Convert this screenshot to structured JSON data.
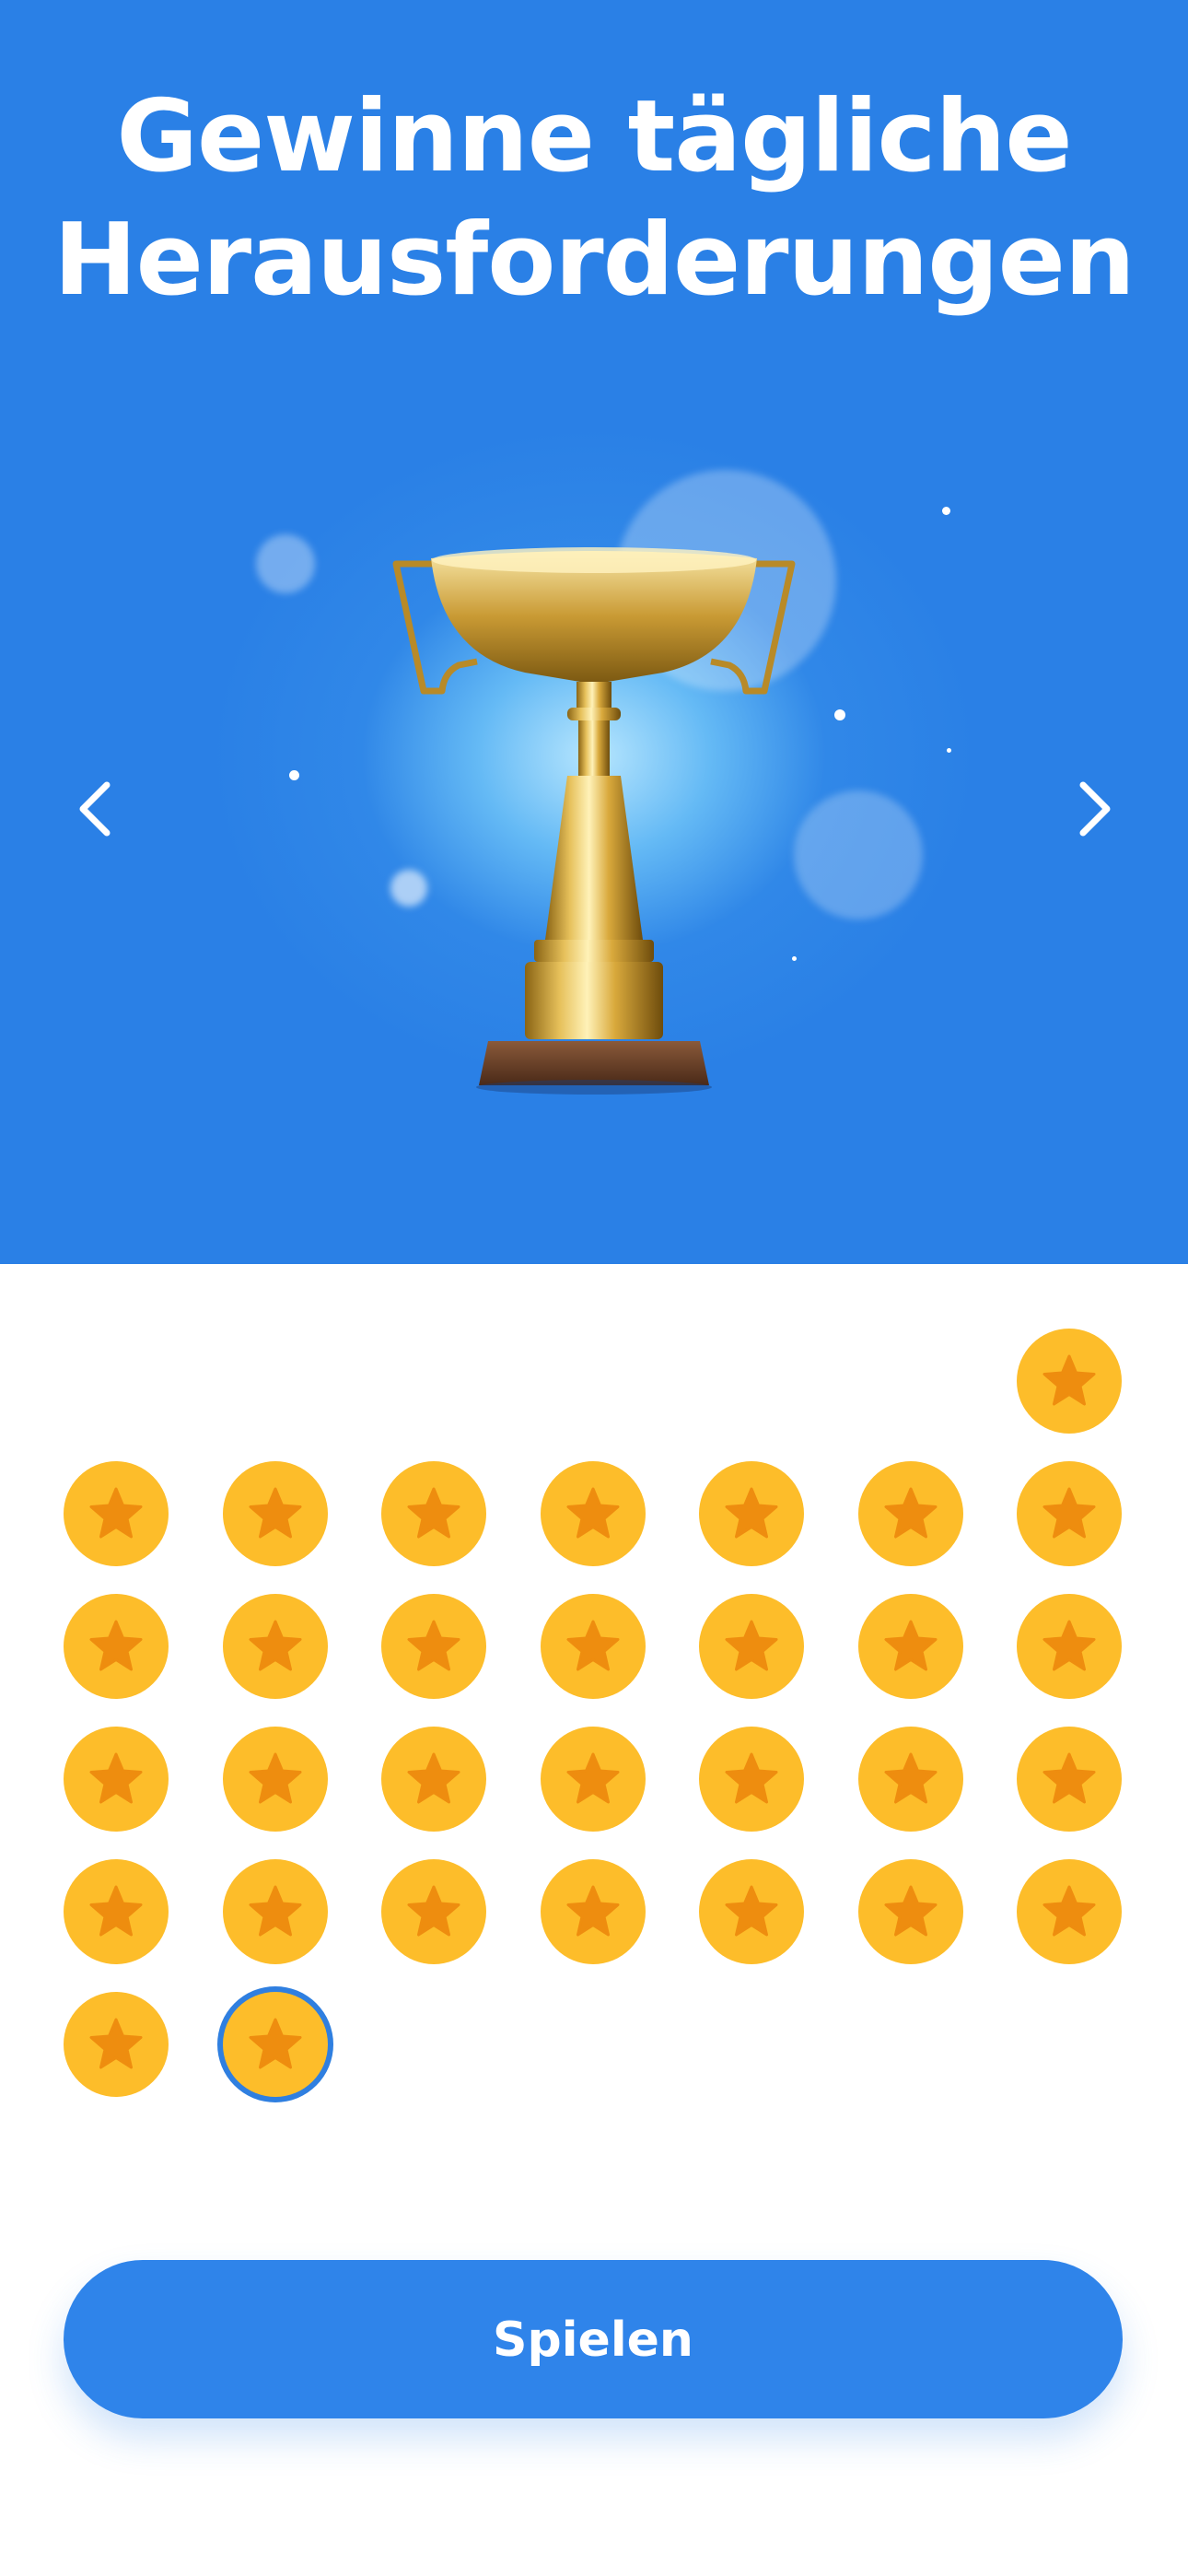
{
  "hero": {
    "title_line1": "Gewinne tägliche",
    "title_line2": "Herausforderungen",
    "background_color": "#2a80e6",
    "prev_arrow_icon": "chevron-left-icon",
    "next_arrow_icon": "chevron-right-icon",
    "image_icon": "trophy-icon"
  },
  "coin_grid": {
    "coin_color": "#fdbd2a",
    "star_color": "#ee8d0f",
    "highlight_color": "#2f7fe0",
    "icon": "star-icon",
    "total_coins": 31,
    "current_index": 30
  },
  "play_button": {
    "label": "Spielen",
    "color": "#2f84ea"
  }
}
